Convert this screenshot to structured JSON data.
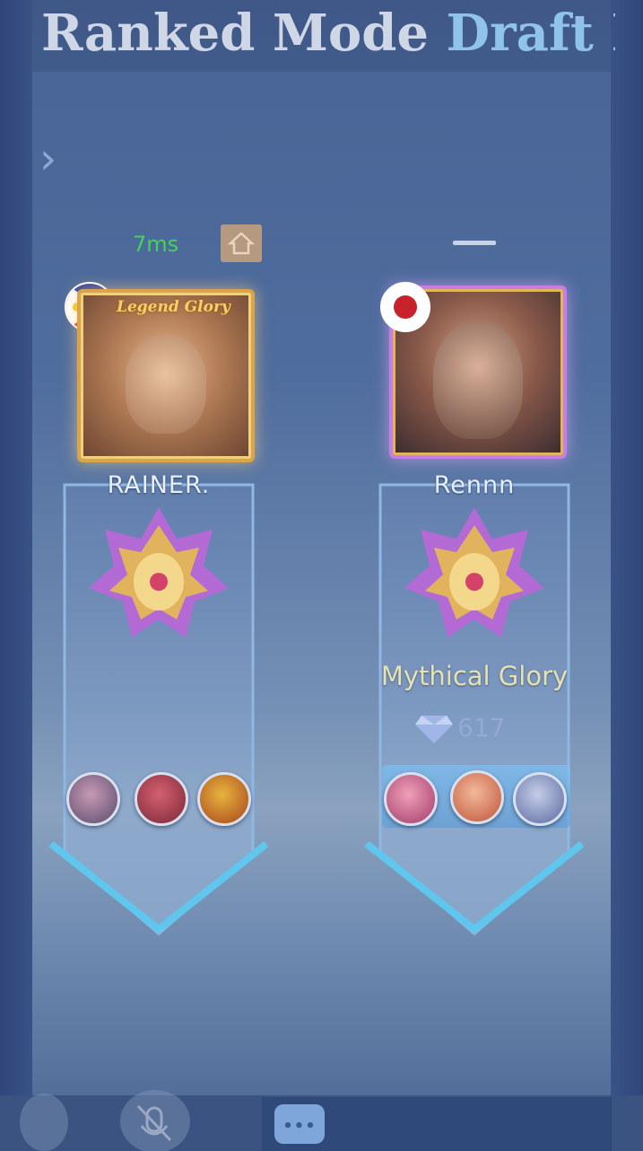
{
  "title": {
    "part1": "Ranked Mode",
    "part2": "Draft I"
  },
  "top": {
    "ping": "7ms"
  },
  "players": [
    {
      "name": "RAINER.",
      "flag": "philippines-flag",
      "frame_text": "Legend Glory",
      "rank_text": "",
      "stars": "",
      "heroes": [
        "hero-1",
        "hero-2",
        "hero-3"
      ]
    },
    {
      "name": "Rennn",
      "flag": "japan-flag",
      "frame_text": "",
      "rank_text": "Mythical Glory",
      "stars": "617",
      "heroes": [
        "hero-1",
        "hero-2",
        "hero-3"
      ]
    }
  ],
  "bottom_bar": {
    "chat_icon": "chat-bubble-icon",
    "voice_icon": "microphone-icon"
  },
  "colors": {
    "ping": "#41d35a",
    "accent": "#8fc3ec",
    "rank": "#e6e2b0"
  }
}
